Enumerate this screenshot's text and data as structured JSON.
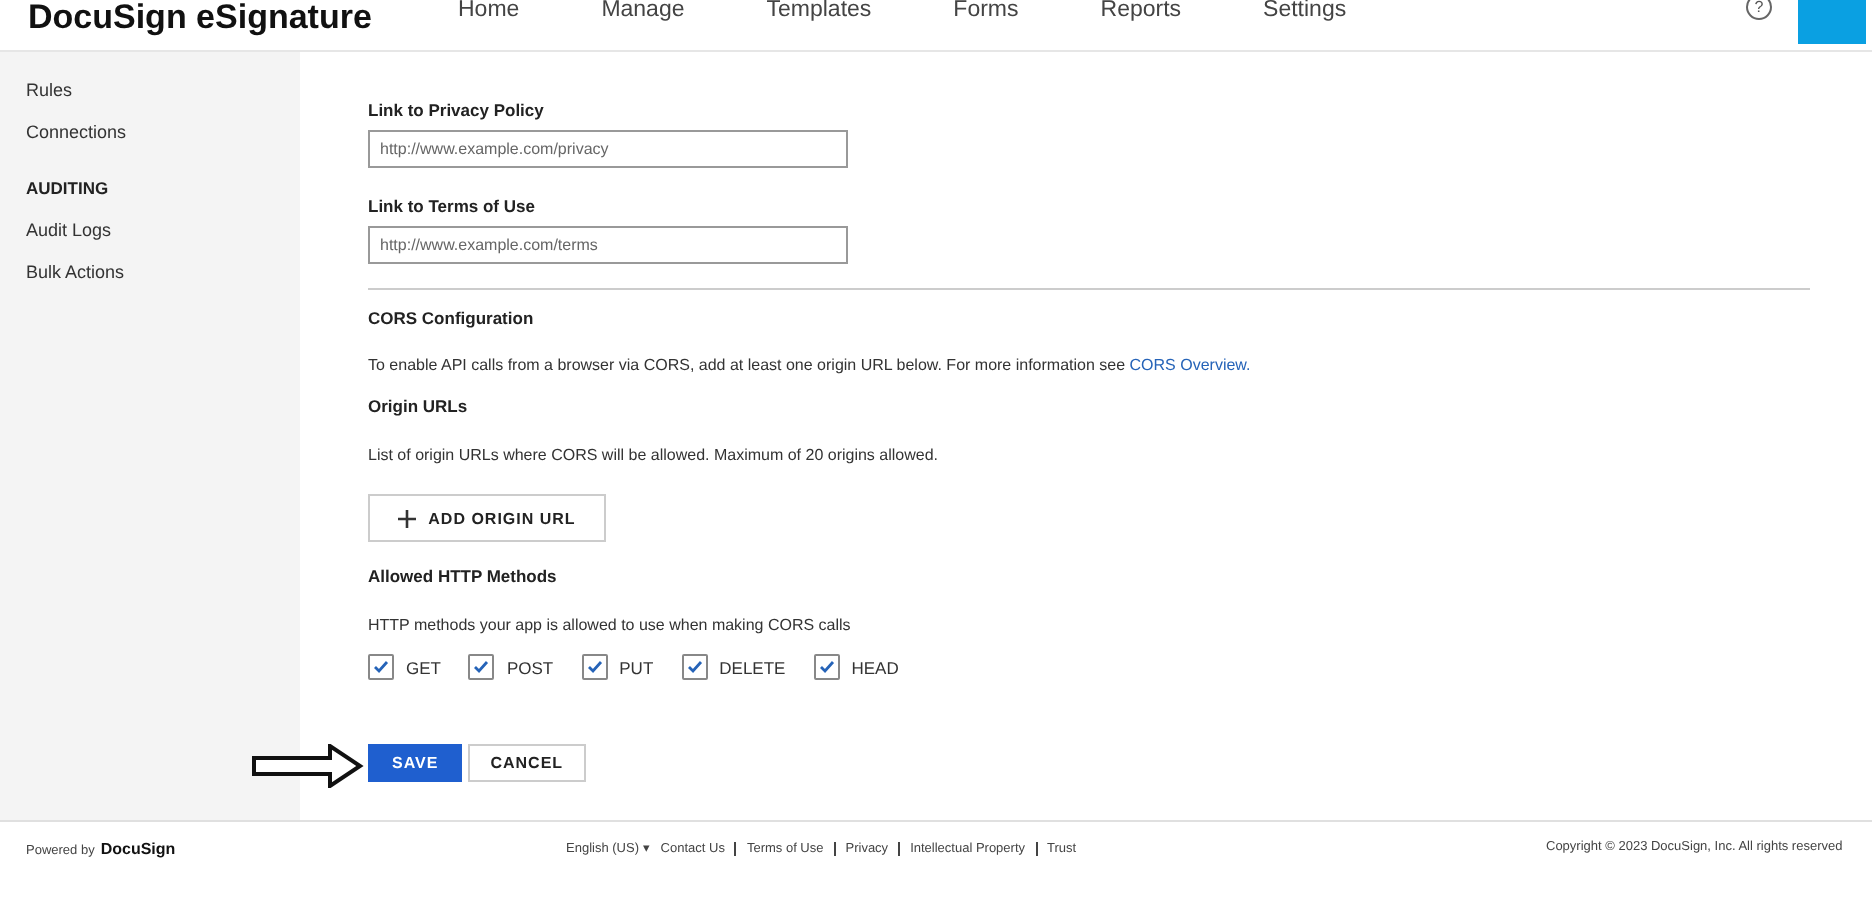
{
  "header": {
    "logo": "DocuSign eSignature",
    "nav": [
      {
        "label": "Home"
      },
      {
        "label": "Manage"
      },
      {
        "label": "Templates"
      },
      {
        "label": "Forms"
      },
      {
        "label": "Reports"
      },
      {
        "label": "Settings"
      }
    ],
    "help": "?"
  },
  "sidebar": {
    "sections": [
      {
        "items": [
          "Rules",
          "Connections"
        ]
      },
      {
        "heading": "AUDITING",
        "items": [
          "Audit Logs",
          "Bulk Actions"
        ]
      }
    ]
  },
  "links": [
    {
      "label": "Link to Privacy Policy",
      "placeholder": "http://www.example.com/privacy"
    },
    {
      "label": "Link to Terms of Use",
      "placeholder": "http://www.example.com/terms"
    }
  ],
  "cors": {
    "title": "CORS Configuration",
    "intro": "To enable API calls from a browser via CORS, add at least one origin URL below. For more information see ",
    "intro_link": "CORS Overview.",
    "origins_title": "Origin URLs",
    "origins_hint": "List of origin URLs where CORS will be allowed. Maximum of 20 origins allowed.",
    "add_origin": "ADD ORIGIN URL",
    "methods_title": "Allowed HTTP Methods",
    "methods_hint": "HTTP methods your app is allowed to use when making CORS calls",
    "methods": [
      {
        "label": "GET",
        "checked": true
      },
      {
        "label": "POST",
        "checked": true
      },
      {
        "label": "PUT",
        "checked": true
      },
      {
        "label": "DELETE",
        "checked": true
      },
      {
        "label": "HEAD",
        "checked": true
      }
    ]
  },
  "actions": {
    "save": "SAVE",
    "cancel": "CANCEL"
  },
  "footer": {
    "powered": "Powered by",
    "brand": "DocuSign",
    "language": "English (US) ▾",
    "links": [
      "Contact Us",
      "Terms of Use",
      "Privacy",
      "Intellectual Property",
      "Trust"
    ],
    "copyright": "Copyright © 2023 DocuSign, Inc. All rights reserved"
  }
}
